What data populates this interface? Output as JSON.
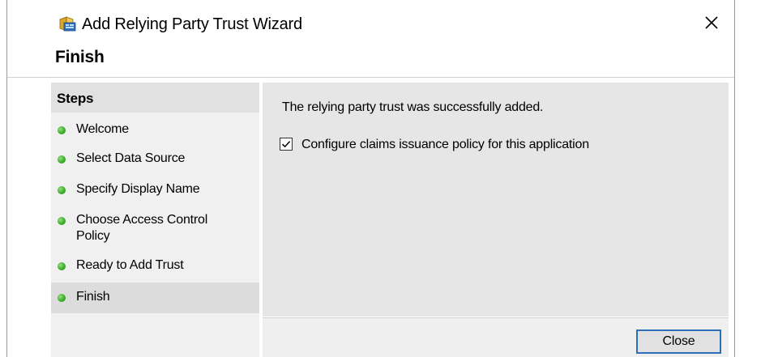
{
  "window": {
    "title": "Add Relying Party Trust Wizard",
    "icon": "relying-party-wizard-icon",
    "close_icon": "close-icon"
  },
  "page": {
    "heading": "Finish"
  },
  "steps": {
    "header": "Steps",
    "items": [
      {
        "label": "Welcome",
        "status": "complete",
        "selected": false
      },
      {
        "label": "Select Data Source",
        "status": "complete",
        "selected": false
      },
      {
        "label": "Specify Display Name",
        "status": "complete",
        "selected": false
      },
      {
        "label": "Choose Access Control Policy",
        "status": "complete",
        "selected": false
      },
      {
        "label": "Ready to Add Trust",
        "status": "complete",
        "selected": false
      },
      {
        "label": "Finish",
        "status": "complete",
        "selected": true
      }
    ],
    "status_color": "#3fae2a"
  },
  "content": {
    "message": "The relying party trust was successfully added.",
    "checkbox_label": "Configure claims issuance policy for this application",
    "checkbox_checked": true
  },
  "buttons": {
    "close_label": "Close"
  },
  "colors": {
    "accent_border": "#2d6fb8",
    "content_background": "#e6e6e6",
    "steps_background": "#f0f0f0"
  }
}
